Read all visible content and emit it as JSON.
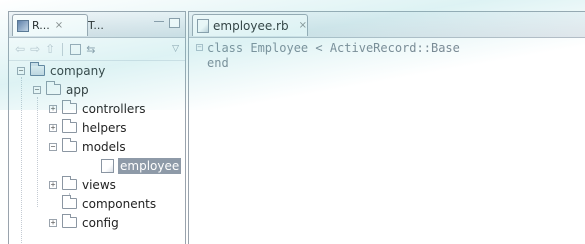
{
  "left_panel": {
    "tabs": [
      {
        "label": "R...",
        "close": "⨯"
      },
      {
        "label": "T...",
        "close": ""
      }
    ]
  },
  "tree": {
    "items": [
      {
        "label": "company",
        "expander": "−"
      },
      {
        "label": "app",
        "expander": "−"
      },
      {
        "label": "controllers",
        "expander": "+"
      },
      {
        "label": "helpers",
        "expander": "+"
      },
      {
        "label": "models",
        "expander": "−"
      },
      {
        "label": "employee",
        "expander": ""
      },
      {
        "label": "views",
        "expander": "+"
      },
      {
        "label": "components",
        "expander": ""
      },
      {
        "label": "config",
        "expander": "+"
      }
    ]
  },
  "editor": {
    "tab_label": "employee.rb",
    "tab_close": "⨯",
    "fold_marker": "−",
    "lines": [
      "class Employee < ActiveRecord::Base",
      "end"
    ]
  }
}
